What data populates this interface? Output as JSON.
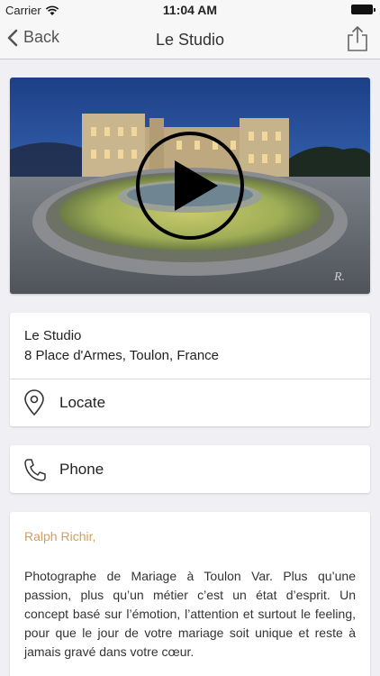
{
  "status_bar": {
    "carrier": "Carrier",
    "time": "11:04 AM"
  },
  "nav": {
    "back_label": "Back",
    "title": "Le Studio"
  },
  "hero": {
    "play_icon": "play-icon"
  },
  "address": {
    "name": "Le Studio",
    "line": "8 Place d'Armes, Toulon, France"
  },
  "locate": {
    "label": "Locate",
    "icon": "location-pin-icon"
  },
  "phone": {
    "label": "Phone",
    "icon": "phone-icon"
  },
  "description": {
    "author": "Ralph Richir,",
    "text": "Photographe de Mariage à Toulon Var. Plus qu’une passion, plus qu’un métier c’est un état d’esprit. Un concept basé sur l’émotion, l’attention et surtout le feeling, pour que le jour de votre mariage soit unique et reste à jamais gravé dans votre cœur."
  },
  "colors": {
    "accent": "#d3a05f",
    "background": "#efeff4",
    "nav_bg": "#f7f7f7"
  }
}
